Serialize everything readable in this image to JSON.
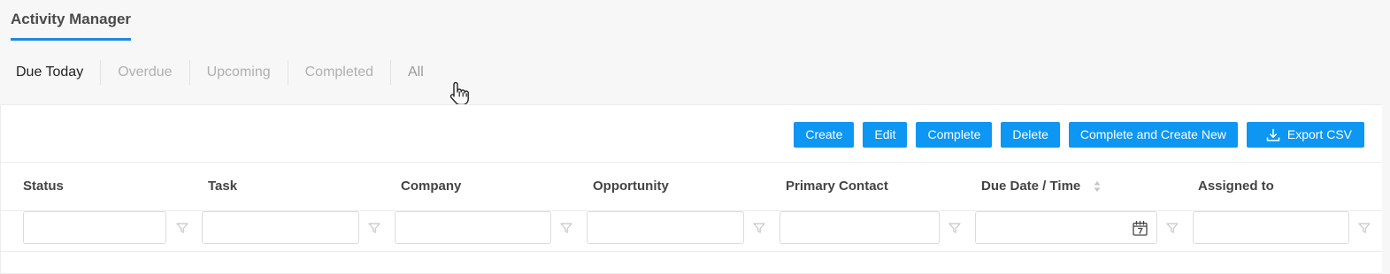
{
  "header": {
    "title": "Activity Manager"
  },
  "tabs": [
    {
      "label": "Due Today",
      "active": true
    },
    {
      "label": "Overdue"
    },
    {
      "label": "Upcoming"
    },
    {
      "label": "Completed"
    },
    {
      "label": "All"
    }
  ],
  "toolbar": {
    "create_label": "Create",
    "edit_label": "Edit",
    "complete_label": "Complete",
    "delete_label": "Delete",
    "complete_create_label": "Complete and Create New",
    "export_label": "Export CSV"
  },
  "table": {
    "columns": [
      {
        "label": "Status"
      },
      {
        "label": "Task"
      },
      {
        "label": "Company"
      },
      {
        "label": "Opportunity"
      },
      {
        "label": "Primary Contact"
      },
      {
        "label": "Due Date / Time",
        "sortable": true
      },
      {
        "label": "Assigned to"
      }
    ],
    "filters": [
      "",
      "",
      "",
      "",
      "",
      "",
      ""
    ]
  },
  "icons": {
    "cursor": "hand-pointer-icon",
    "filter": "filter-icon",
    "calendar": "calendar-icon",
    "export": "download-icon",
    "sort": "sort-icon"
  },
  "colors": {
    "accent": "#1e88e5",
    "button": "#0d96f2",
    "background": "#f7f7f7"
  }
}
